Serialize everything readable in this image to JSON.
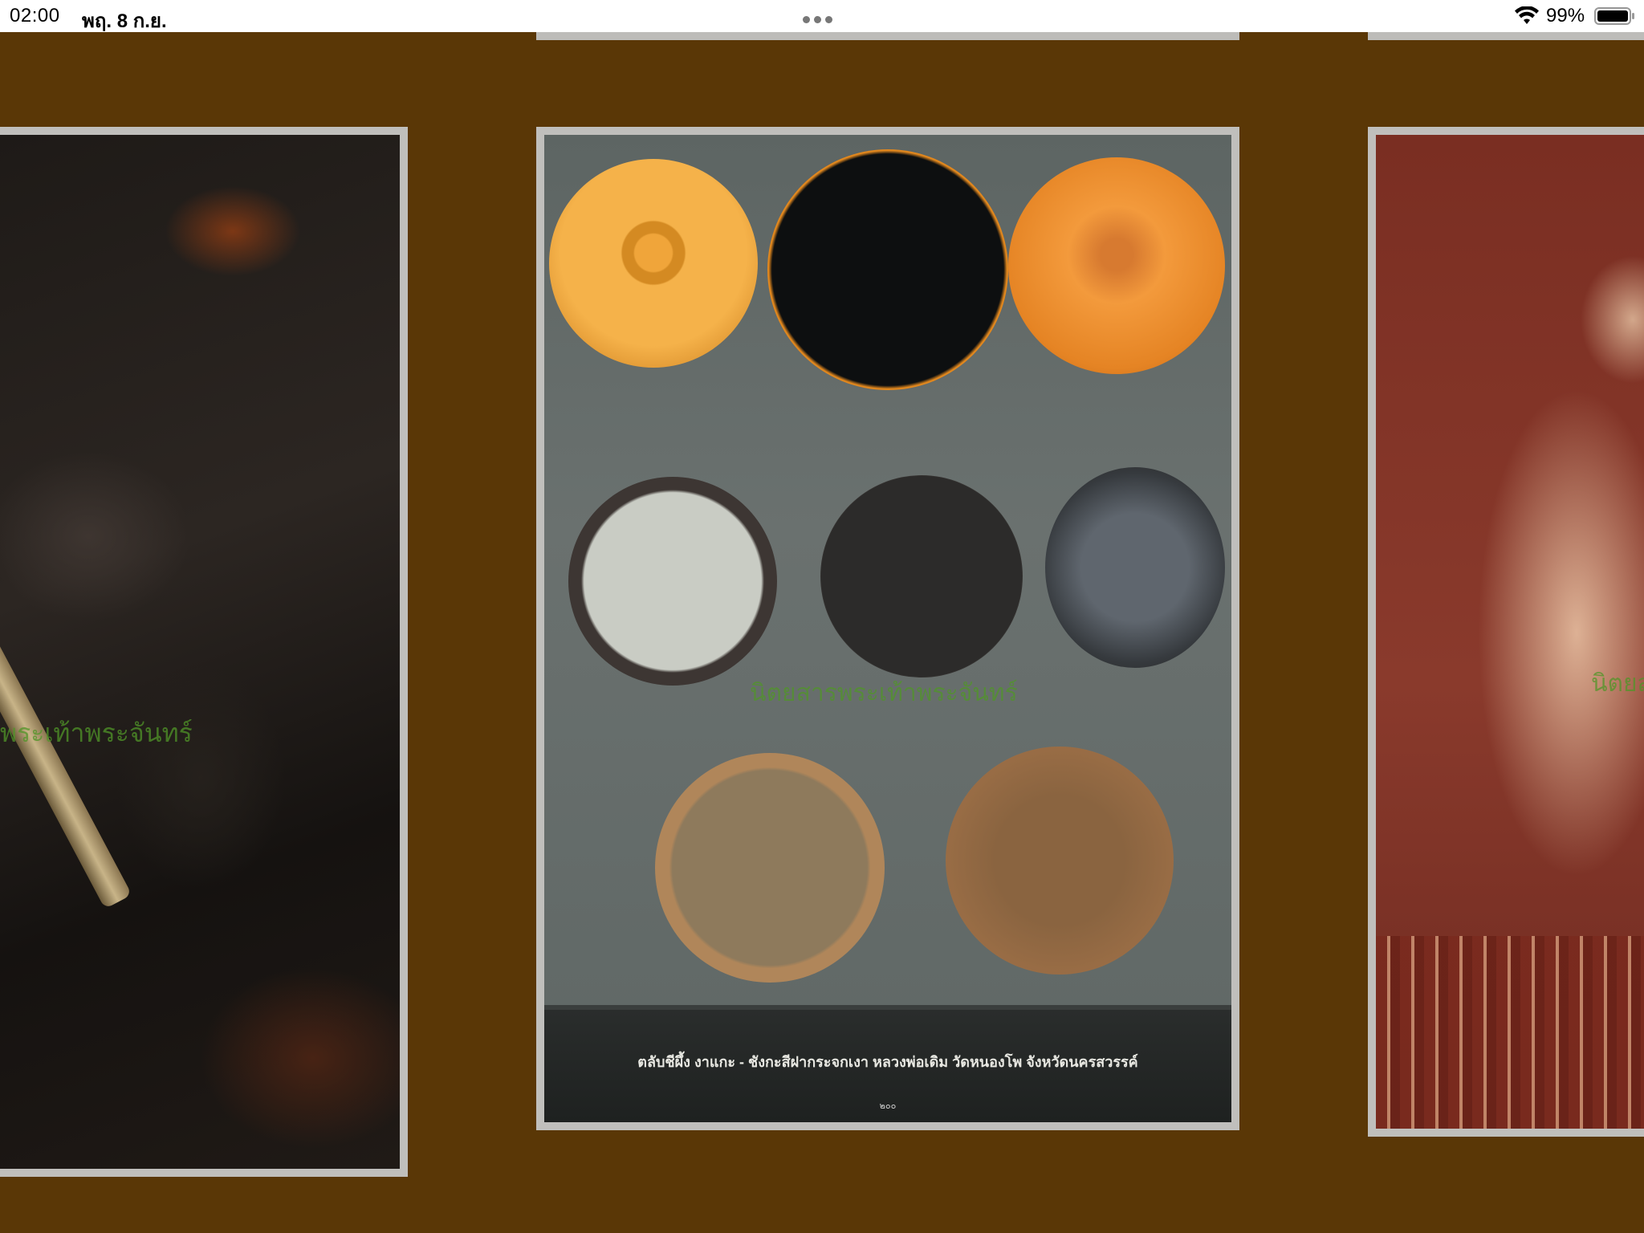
{
  "status_bar": {
    "time": "02:00",
    "date": "พฤ. 8 ก.ย.",
    "battery_percent": "99%",
    "wifi_icon": "wifi-icon",
    "battery_icon": "battery-icon"
  },
  "gallery": {
    "background_color": "#5a3706",
    "center_slide": {
      "caption": "ตลับชีผึ้ง งาแกะ - ชังกะสีฝากระจกเงา หลวงพ่อเดิม วัดหนองโพ จังหวัดนครสวรรค์",
      "page_number": "๒๐๐",
      "watermark": "นิตยสารพระเท้าพระจันทร์"
    },
    "left_slide": {
      "watermark": "พระเท้าพระจันทร์"
    },
    "right_slide": {
      "watermark": "นิตยส"
    }
  }
}
